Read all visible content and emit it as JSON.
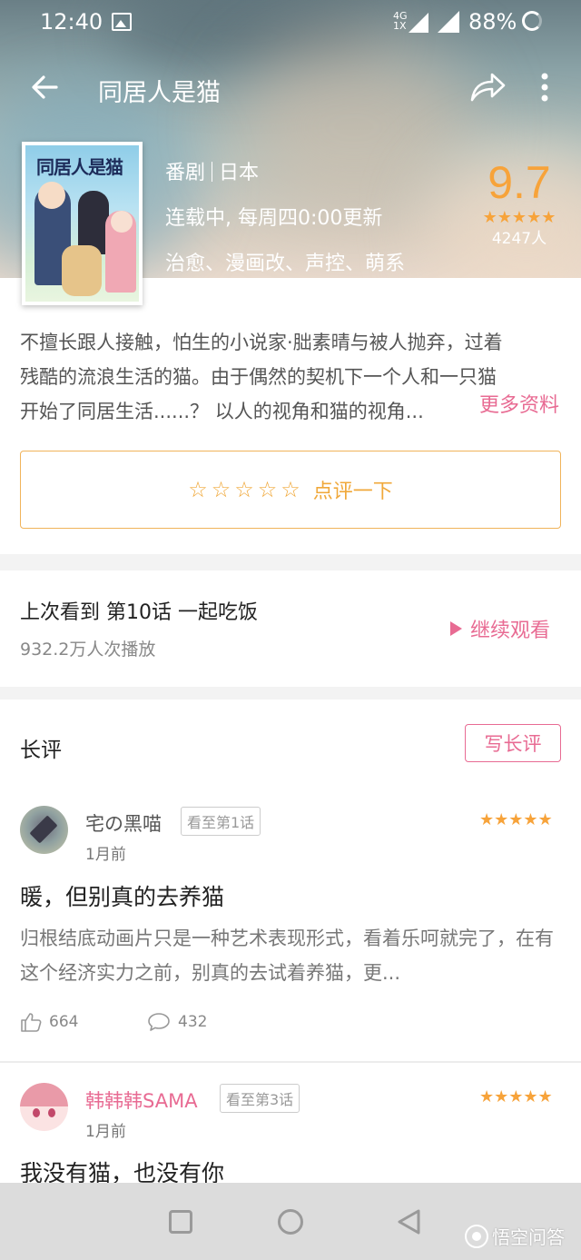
{
  "status_bar": {
    "time": "12:40",
    "network": "4G",
    "network_sub": "1X",
    "battery": "88%"
  },
  "toolbar": {
    "title": "同居人是猫"
  },
  "poster": {
    "title": "同居人是猫"
  },
  "meta": {
    "type": "番剧",
    "region": "日本",
    "schedule": "连载中, 每周四0:00更新",
    "tags": "治愈、漫画改、声控、萌系"
  },
  "score": {
    "value": "9.7",
    "stars": "★★★★★",
    "count": "4247人"
  },
  "description": {
    "line1": "不擅长跟人接触，怕生的小说家·朏素晴与被人抛弃，过着",
    "line2": "残酷的流浪生活的猫。由于偶然的契机下一个人和一只猫",
    "line3": "开始了同居生活......？ 以人的视角和猫的视角...",
    "more": "更多资料"
  },
  "rate": {
    "stars": "☆☆☆☆☆",
    "label": "点评一下"
  },
  "last_watched": {
    "title": "上次看到 第10话 一起吃饭",
    "plays": "932.2万人次播放",
    "continue": "继续观看"
  },
  "long_reviews": {
    "heading": "长评",
    "write_button": "写长评",
    "items": [
      {
        "user": "宅の黑喵",
        "user_color": "#555555",
        "progress": "看至第1话",
        "time": "1月前",
        "stars": "★★★★★",
        "title": "暖，但别真的去养猫",
        "body": "归根结底动画片只是一种艺术表现形式，看着乐呵就完了，在有这个经济实力之前，别真的去试着养猫，更...",
        "likes": "664",
        "comments": "432"
      },
      {
        "user": "韩韩韩SAMA",
        "user_color": "#e86b93",
        "progress": "看至第3话",
        "time": "1月前",
        "stars": "★★★★★",
        "title": "我没有猫，也没有你"
      }
    ]
  },
  "watermark": "悟空问答",
  "colors": {
    "accent_pink": "#e86b93",
    "accent_orange": "#f7a33a"
  }
}
